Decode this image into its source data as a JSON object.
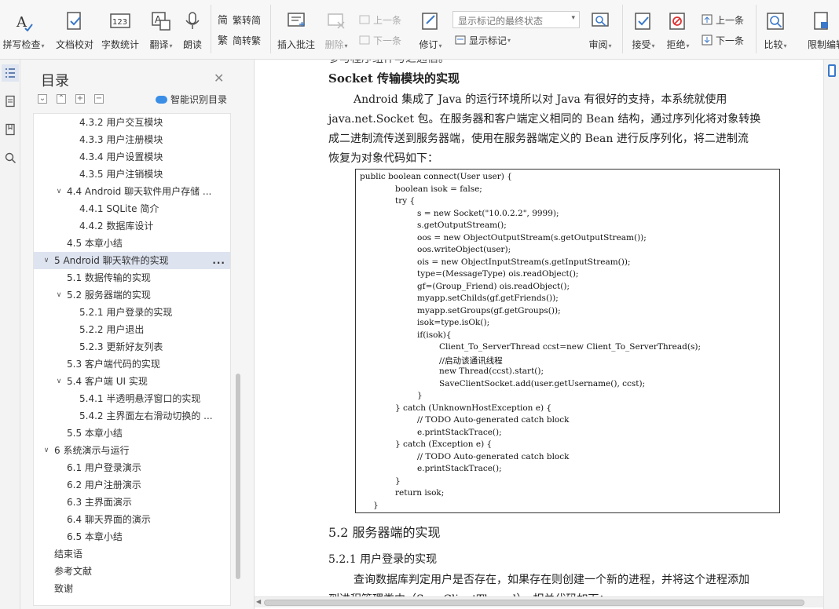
{
  "toolbar": {
    "spell_check": "拼写检查",
    "doc_proof": "文档校对",
    "word_count": "字数统计",
    "translate": "翻译",
    "read_aloud": "朗读",
    "to_traditional": "繁转简",
    "to_simplified": "简转繁",
    "insert_comment": "插入批注",
    "delete": "删除",
    "prev": "上一条",
    "next": "下一条",
    "revise": "修订",
    "markup_state": "显示标记的最终状态",
    "show_markup": "显示标记",
    "review": "审阅",
    "accept": "接受",
    "reject": "拒绝",
    "prev2": "上一条",
    "next2": "下一条",
    "compare": "比较",
    "restrict_edit": "限制编辑"
  },
  "toc": {
    "title": "目录",
    "ai_label": "智能识别目录",
    "items": [
      {
        "text": "4.3.2  用户交互模块"
      },
      {
        "text": "4.3.3  用户注册模块"
      },
      {
        "text": "4.3.4  用户设置模块"
      },
      {
        "text": "4.3.5  用户注销模块"
      },
      {
        "text": "4.4  Android 聊天软件用户存储 ..."
      },
      {
        "text": "4.4.1  SQLite 简介"
      },
      {
        "text": "4.4.2  数据库设计"
      },
      {
        "text": "4.5  本章小结"
      },
      {
        "text": "5  Android 聊天软件的实现"
      },
      {
        "text": "5.1  数据传输的实现"
      },
      {
        "text": "5.2  服务器端的实现"
      },
      {
        "text": "5.2.1  用户登录的实现"
      },
      {
        "text": "5.2.2  用户退出"
      },
      {
        "text": "5.2.3  更新好友列表"
      },
      {
        "text": "5.3  客户端代码的实现"
      },
      {
        "text": "5.4  客户端 UI 实现"
      },
      {
        "text": "5.4.1  半透明悬浮窗口的实现"
      },
      {
        "text": "5.4.2  主界面左右滑动切换的 ..."
      },
      {
        "text": "5.5  本章小结"
      },
      {
        "text": "6  系统演示与运行"
      },
      {
        "text": "6.1  用户登录演示"
      },
      {
        "text": "6.2  用户注册演示"
      },
      {
        "text": "6.3  主界面演示"
      },
      {
        "text": "6.4  聊天界面的演示"
      },
      {
        "text": "6.5  本章小结"
      },
      {
        "text": "结束语"
      },
      {
        "text": "参考文献"
      },
      {
        "text": "致谢"
      }
    ],
    "more": "..."
  },
  "doc": {
    "top_cut": "参与程序组件与之通信。",
    "heading_socket": "Socket 传输模块的实现",
    "para1": [
      "Android 集成了 Java 的运行环境所以对 Java 有很好的支持，本系统就使用",
      "java.net.Socket 包。在服务器和客户端定义相同的 Bean 结构，通过序列化将对象转换",
      "成二进制流传送到服务器端，使用在服务器端定义的 Bean 进行反序列化，将二进制流",
      "恢复为对象代码如下："
    ],
    "code": [
      "public boolean connect(User user) {",
      "boolean isok = false;",
      "try {",
      "s = new Socket(\"10.0.2.2\", 9999);",
      "s.getOutputStream();",
      "oos = new ObjectOutputStream(s.getOutputStream());",
      "oos.writeObject(user);",
      "ois = new ObjectInputStream(s.getInputStream());",
      "type=(MessageType) ois.readObject();",
      "gf=(Group_Friend) ois.readObject();",
      "myapp.setChilds(gf.getFriends());",
      "myapp.setGroups(gf.getGroups());",
      "isok=type.isOk();",
      "if(isok){",
      "Client_To_ServerThread ccst=new Client_To_ServerThread(s);",
      "//启动该通讯线程",
      "new Thread(ccst).start();",
      "SaveClientSocket.add(user.getUsername(), ccst);",
      "}",
      "} catch (UnknownHostException e) {",
      "// TODO Auto-generated catch block",
      "e.printStackTrace();",
      "} catch (Exception e) {",
      "// TODO Auto-generated catch block",
      "e.printStackTrace();",
      "}",
      "return isok;",
      "}"
    ],
    "heading_52": "5.2   服务器端的实现",
    "heading_521": "5.2.1   用户登录的实现",
    "para2": [
      "查询数据库判定用户是否存在，如果存在则创建一个新的进程，并将这个进程添加",
      "到进程管理类中（SaveClientThread），相关代码如下："
    ]
  }
}
